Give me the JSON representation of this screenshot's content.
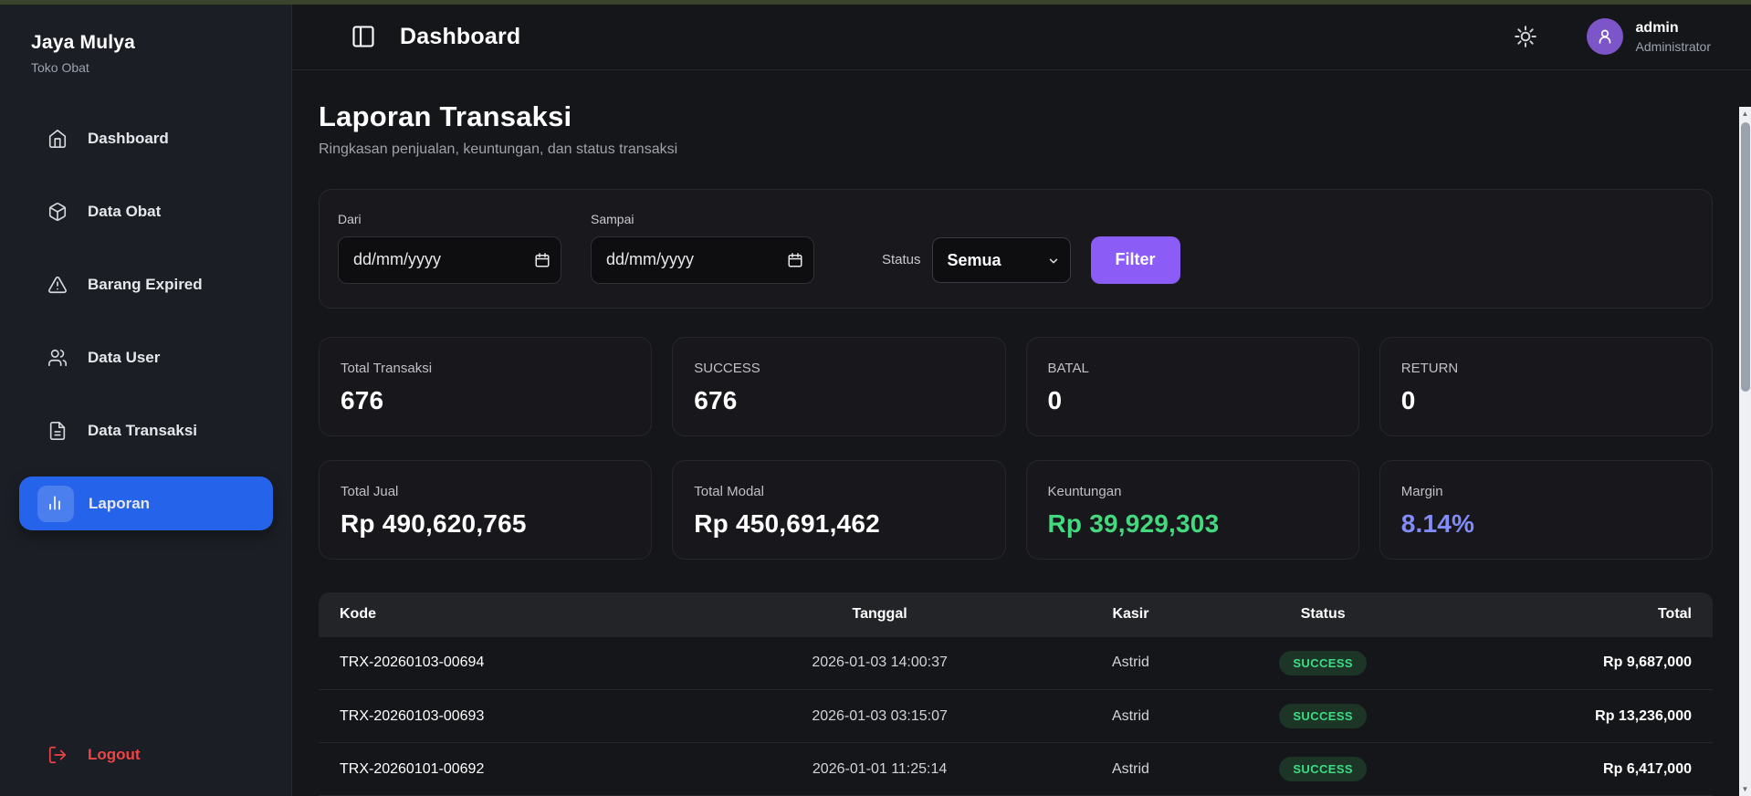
{
  "brand": {
    "title": "Jaya Mulya",
    "subtitle": "Toko Obat"
  },
  "sidebar": {
    "items": [
      {
        "label": "Dashboard",
        "icon": "home-icon",
        "active": false
      },
      {
        "label": "Data Obat",
        "icon": "package-icon",
        "active": false
      },
      {
        "label": "Barang Expired",
        "icon": "alert-triangle-icon",
        "active": false
      },
      {
        "label": "Data User",
        "icon": "users-icon",
        "active": false
      },
      {
        "label": "Data Transaksi",
        "icon": "file-text-icon",
        "active": false
      },
      {
        "label": "Laporan",
        "icon": "bar-chart-icon",
        "active": true
      }
    ],
    "logout_label": "Logout"
  },
  "header": {
    "title": "Dashboard",
    "user_name": "admin",
    "user_role": "Administrator"
  },
  "page": {
    "title": "Laporan Transaksi",
    "subtitle": "Ringkasan penjualan, keuntungan, dan status transaksi"
  },
  "filters": {
    "dari_label": "Dari",
    "sampai_label": "Sampai",
    "date_placeholder": "dd/mm/yyyy",
    "status_label": "Status",
    "status_value": "Semua",
    "filter_button": "Filter"
  },
  "stats": {
    "cards": [
      {
        "label": "Total Transaksi",
        "value": "676",
        "color": "#ffffff"
      },
      {
        "label": "SUCCESS",
        "value": "676",
        "color": "#ffffff"
      },
      {
        "label": "BATAL",
        "value": "0",
        "color": "#ffffff"
      },
      {
        "label": "RETURN",
        "value": "0",
        "color": "#ffffff"
      },
      {
        "label": "Total Jual",
        "value": "Rp 490,620,765",
        "color": "#ffffff"
      },
      {
        "label": "Total Modal",
        "value": "Rp 450,691,462",
        "color": "#ffffff"
      },
      {
        "label": "Keuntungan",
        "value": "Rp 39,929,303",
        "color": "#43d97f"
      },
      {
        "label": "Margin",
        "value": "8.14%",
        "color": "#818cf8"
      }
    ]
  },
  "table": {
    "columns": [
      "Kode",
      "Tanggal",
      "Kasir",
      "Status",
      "Total"
    ],
    "rows": [
      {
        "kode": "TRX-20260103-00694",
        "tanggal": "2026-01-03 14:00:37",
        "kasir": "Astrid",
        "status": "SUCCESS",
        "total": "Rp 9,687,000"
      },
      {
        "kode": "TRX-20260103-00693",
        "tanggal": "2026-01-03 03:15:07",
        "kasir": "Astrid",
        "status": "SUCCESS",
        "total": "Rp 13,236,000"
      },
      {
        "kode": "TRX-20260101-00692",
        "tanggal": "2026-01-01 11:25:14",
        "kasir": "Astrid",
        "status": "SUCCESS",
        "total": "Rp 6,417,000"
      }
    ]
  },
  "colors": {
    "accent_blue": "#2563eb",
    "accent_purple": "#8b5cf6",
    "avatar_purple": "#7c56c8",
    "profit_green": "#43d97f",
    "margin_indigo": "#818cf8",
    "logout_red": "#ef4444",
    "status_badge": {
      "SUCCESS": {
        "bg": "#1c3527",
        "text": "#3ddc84"
      }
    }
  }
}
